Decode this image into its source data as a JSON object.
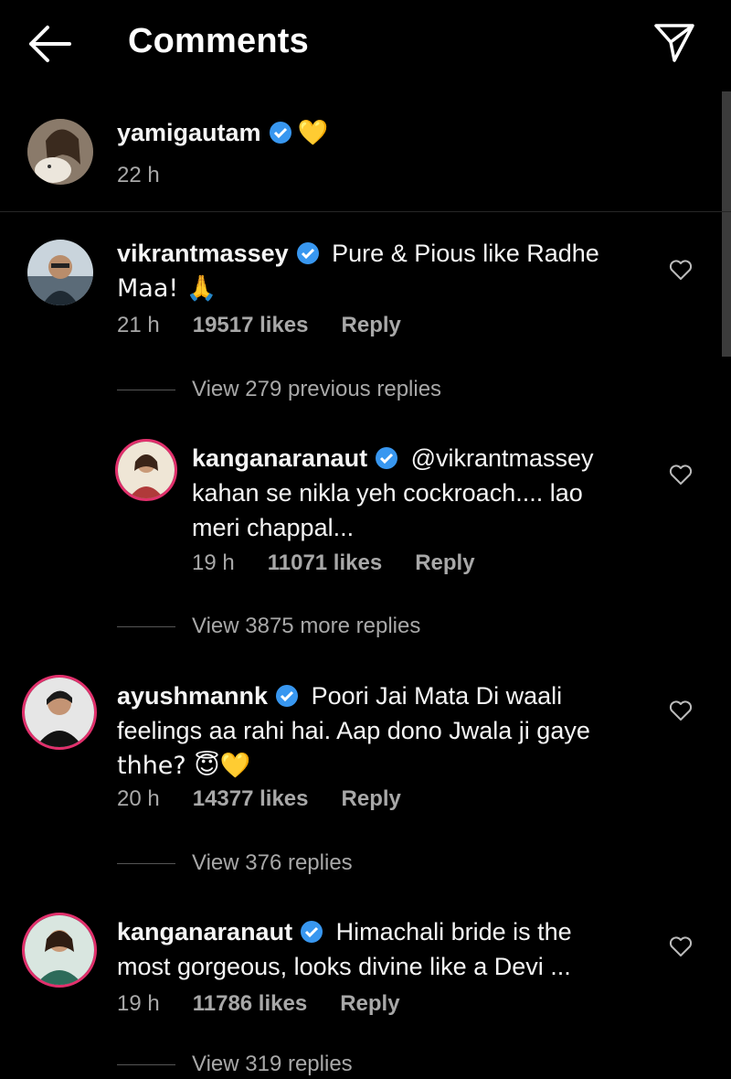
{
  "header": {
    "title": "Comments"
  },
  "caption": {
    "username": "yamigautam",
    "emoji": "💛",
    "time": "22 h"
  },
  "comments": [
    {
      "username": "vikrantmassey",
      "line1": "Pure & Pious like Radhe",
      "line2": "Maa! 🙏",
      "time": "21 h",
      "likes": "19517 likes",
      "reply": "Reply"
    },
    {
      "view_more": "View 279 previous replies"
    },
    {
      "username": "kanganaranaut",
      "line1": "@vikrantmassey",
      "line2": "kahan se nikla yeh cockroach.... lao",
      "line3": "meri chappal...",
      "time": "19 h",
      "likes": "11071 likes",
      "reply": "Reply"
    },
    {
      "view_more": "View 3875 more replies"
    },
    {
      "username": "ayushmannk",
      "line1": "Poori Jai Mata Di waali",
      "line2": "feelings aa rahi hai. Aap dono Jwala ji gaye",
      "line3": "thhe? 😇💛",
      "time": "20 h",
      "likes": "14377 likes",
      "reply": "Reply"
    },
    {
      "view_more": "View 376 replies"
    },
    {
      "username": "kanganaranaut",
      "line1": "Himachali bride is the",
      "line2": "most gorgeous, looks divine like a Devi ...",
      "time": "19 h",
      "likes": "11786 likes",
      "reply": "Reply"
    },
    {
      "view_more": "View 319 replies"
    }
  ],
  "icons": {
    "back": "back-arrow-icon",
    "send": "send-icon",
    "verified": "verified-badge-icon",
    "like": "heart-icon"
  },
  "colors": {
    "verified": "#3897f0",
    "story_ring": "#e1306c",
    "muted_text": "#a8a8a8"
  }
}
